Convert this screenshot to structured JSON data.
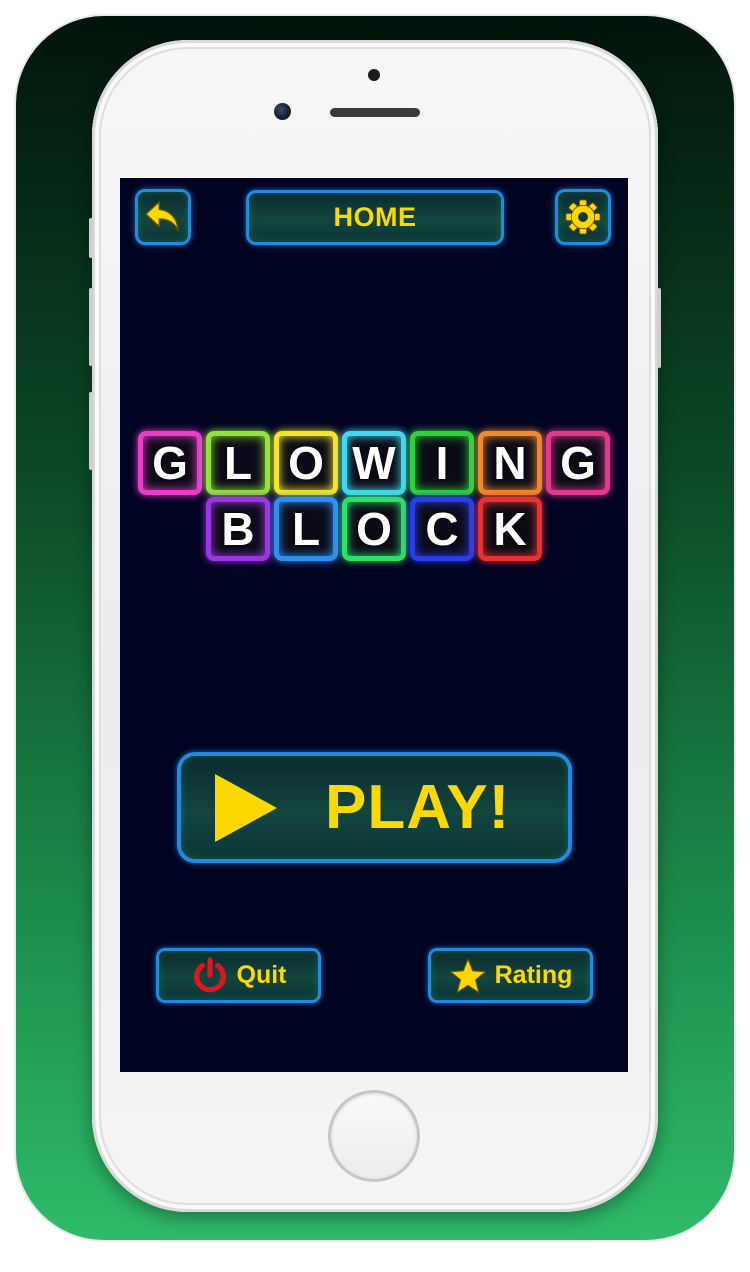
{
  "colors": {
    "accent_yellow": "#ffd800",
    "button_border": "#1f8be2",
    "screen_background": "#010421",
    "quit_icon": "#e0161b"
  },
  "header": {
    "back_icon": "back-arrow-icon",
    "title": "HOME",
    "settings_icon": "gear-icon"
  },
  "logo": {
    "rows": [
      {
        "tiles": [
          {
            "letter": "G",
            "color": "#e83cc9"
          },
          {
            "letter": "L",
            "color": "#8fe43a"
          },
          {
            "letter": "O",
            "color": "#f4e626"
          },
          {
            "letter": "W",
            "color": "#41d8f0"
          },
          {
            "letter": "I",
            "color": "#2fd23b"
          },
          {
            "letter": "N",
            "color": "#f08a2c"
          },
          {
            "letter": "G",
            "color": "#e2378a"
          }
        ]
      },
      {
        "tiles": [
          {
            "letter": "B",
            "color": "#9b35e0"
          },
          {
            "letter": "L",
            "color": "#2c8ff0"
          },
          {
            "letter": "O",
            "color": "#2ee06a"
          },
          {
            "letter": "C",
            "color": "#2b3de8"
          },
          {
            "letter": "K",
            "color": "#e83232"
          }
        ]
      }
    ]
  },
  "play_button": {
    "icon": "play-triangle-icon",
    "label": "PLAY!"
  },
  "quit_button": {
    "icon": "power-icon",
    "label": "Quit"
  },
  "rating_button": {
    "icon": "star-icon",
    "label": "Rating"
  }
}
